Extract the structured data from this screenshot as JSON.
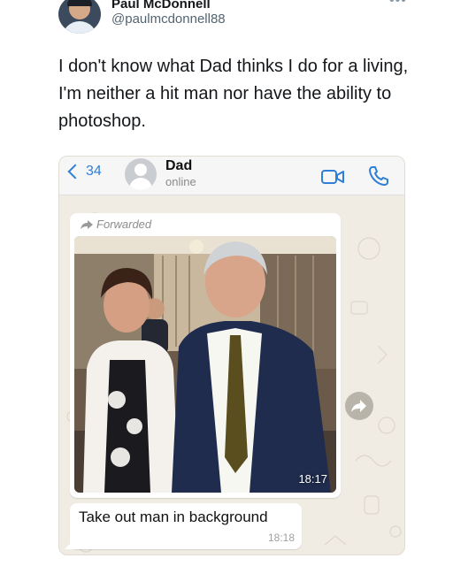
{
  "tweet": {
    "author_name": "Paul McDonnell",
    "author_handle": "@paulmcdonnell88",
    "more_icon": "more-dots-icon",
    "text": "I don't know what Dad thinks I do for a living, I'm neither a hit man nor have the ability to photoshop."
  },
  "whatsapp": {
    "back_count": "34",
    "contact_name": "Dad",
    "contact_status": "online",
    "accent_color": "#2f7fd6",
    "messages": [
      {
        "type": "photo",
        "forwarded_label": "Forwarded",
        "time": "18:17"
      },
      {
        "type": "text",
        "text": "Take out man in background",
        "time": "18:18"
      }
    ]
  }
}
